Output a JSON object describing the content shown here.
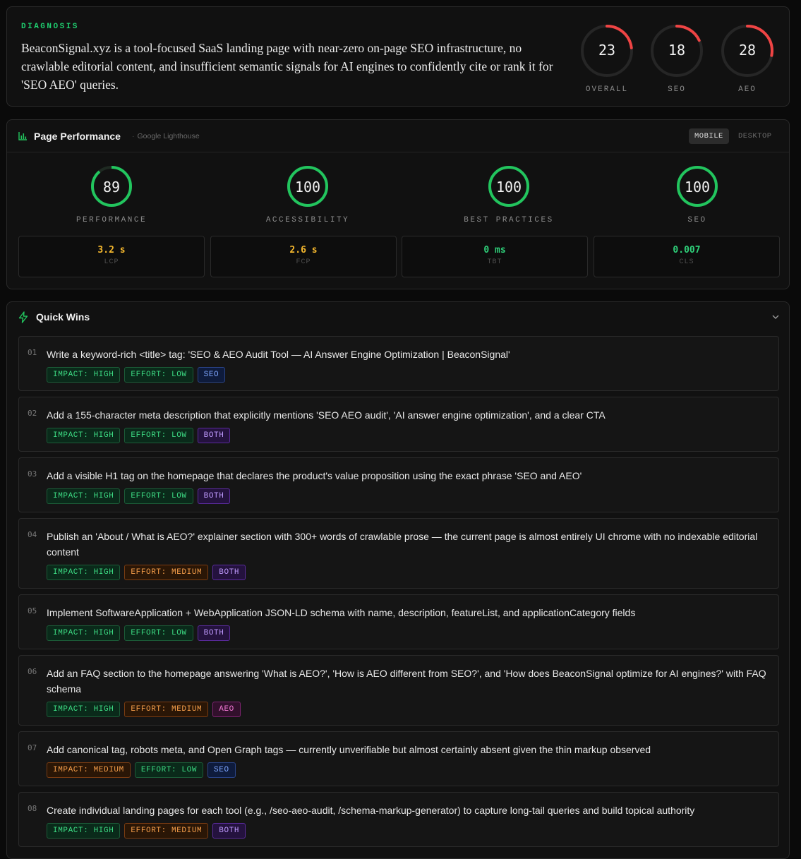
{
  "diagnosis": {
    "label": "DIAGNOSIS",
    "text": "BeaconSignal.xyz is a tool-focused SaaS landing page with near-zero on-page SEO infrastructure, no crawlable editorial content, and insufficient semantic signals for AI engines to confidently cite or rank it for 'SEO AEO' queries.",
    "scores": [
      {
        "value": "23",
        "label": "OVERALL",
        "fraction": 0.23
      },
      {
        "value": "18",
        "label": "SEO",
        "fraction": 0.18
      },
      {
        "value": "28",
        "label": "AEO",
        "fraction": 0.28
      }
    ]
  },
  "performance": {
    "title": "Page Performance",
    "subtitle": "Google Lighthouse",
    "toggle": {
      "mobile": "MOBILE",
      "desktop": "DESKTOP",
      "active": "mobile"
    },
    "gauges": [
      {
        "value": "89",
        "label": "PERFORMANCE",
        "fraction": 0.89
      },
      {
        "value": "100",
        "label": "ACCESSIBILITY",
        "fraction": 1.0
      },
      {
        "value": "100",
        "label": "BEST PRACTICES",
        "fraction": 1.0
      },
      {
        "value": "100",
        "label": "SEO",
        "fraction": 1.0
      }
    ],
    "metrics": [
      {
        "value": "3.2 s",
        "label": "LCP",
        "color": "#f5b82e"
      },
      {
        "value": "2.6 s",
        "label": "FCP",
        "color": "#f5b82e"
      },
      {
        "value": "0 ms",
        "label": "TBT",
        "color": "#2fd07a"
      },
      {
        "value": "0.007",
        "label": "CLS",
        "color": "#2fd07a"
      }
    ]
  },
  "quick_wins": {
    "title": "Quick Wins",
    "items": [
      {
        "num": "01",
        "text": "Write a keyword-rich <title> tag: 'SEO & AEO Audit Tool — AI Answer Engine Optimization | BeaconSignal'",
        "tags": [
          {
            "text": "IMPACT: HIGH",
            "kind": "green"
          },
          {
            "text": "EFFORT: LOW",
            "kind": "green"
          },
          {
            "text": "SEO",
            "kind": "blue"
          }
        ]
      },
      {
        "num": "02",
        "text": "Add a 155-character meta description that explicitly mentions 'SEO AEO audit', 'AI answer engine optimization', and a clear CTA",
        "tags": [
          {
            "text": "IMPACT: HIGH",
            "kind": "green"
          },
          {
            "text": "EFFORT: LOW",
            "kind": "green"
          },
          {
            "text": "BOTH",
            "kind": "purple"
          }
        ]
      },
      {
        "num": "03",
        "text": "Add a visible H1 tag on the homepage that declares the product's value proposition using the exact phrase 'SEO and AEO'",
        "tags": [
          {
            "text": "IMPACT: HIGH",
            "kind": "green"
          },
          {
            "text": "EFFORT: LOW",
            "kind": "green"
          },
          {
            "text": "BOTH",
            "kind": "purple"
          }
        ]
      },
      {
        "num": "04",
        "text": "Publish an 'About / What is AEO?' explainer section with 300+ words of crawlable prose — the current page is almost entirely UI chrome with no indexable editorial content",
        "tags": [
          {
            "text": "IMPACT: HIGH",
            "kind": "green"
          },
          {
            "text": "EFFORT: MEDIUM",
            "kind": "orange"
          },
          {
            "text": "BOTH",
            "kind": "purple"
          }
        ]
      },
      {
        "num": "05",
        "text": "Implement SoftwareApplication + WebApplication JSON-LD schema with name, description, featureList, and applicationCategory fields",
        "tags": [
          {
            "text": "IMPACT: HIGH",
            "kind": "green"
          },
          {
            "text": "EFFORT: LOW",
            "kind": "green"
          },
          {
            "text": "BOTH",
            "kind": "purple"
          }
        ]
      },
      {
        "num": "06",
        "text": "Add an FAQ section to the homepage answering 'What is AEO?', 'How is AEO different from SEO?', and 'How does BeaconSignal optimize for AI engines?' with FAQ schema",
        "tags": [
          {
            "text": "IMPACT: HIGH",
            "kind": "green"
          },
          {
            "text": "EFFORT: MEDIUM",
            "kind": "orange"
          },
          {
            "text": "AEO",
            "kind": "magenta"
          }
        ]
      },
      {
        "num": "07",
        "text": "Add canonical tag, robots meta, and Open Graph tags — currently unverifiable but almost certainly absent given the thin markup observed",
        "tags": [
          {
            "text": "IMPACT: MEDIUM",
            "kind": "orange"
          },
          {
            "text": "EFFORT: LOW",
            "kind": "green"
          },
          {
            "text": "SEO",
            "kind": "blue"
          }
        ]
      },
      {
        "num": "08",
        "text": "Create individual landing pages for each tool (e.g., /seo-aeo-audit, /schema-markup-generator) to capture long-tail queries and build topical authority",
        "tags": [
          {
            "text": "IMPACT: HIGH",
            "kind": "green"
          },
          {
            "text": "EFFORT: MEDIUM",
            "kind": "orange"
          },
          {
            "text": "BOTH",
            "kind": "purple"
          }
        ]
      }
    ]
  }
}
